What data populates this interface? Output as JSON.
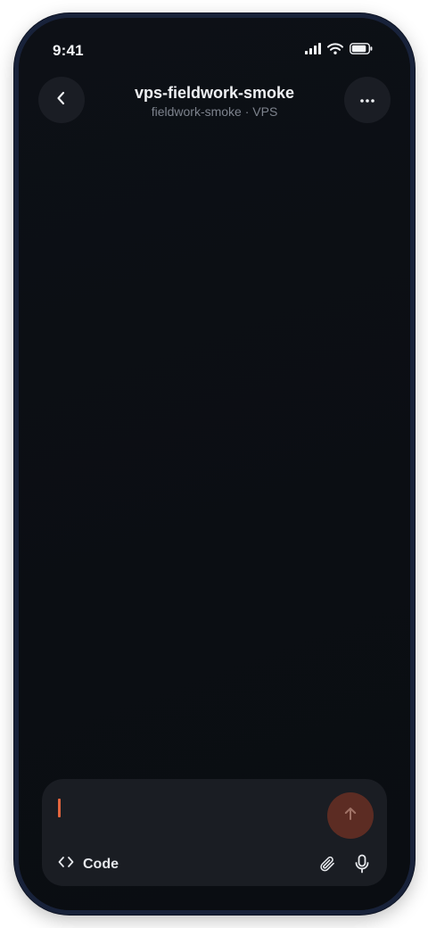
{
  "status_bar": {
    "time": "9:41",
    "icons": [
      "cellular-signal-icon",
      "wifi-icon",
      "battery-icon"
    ]
  },
  "header": {
    "title": "vps-fieldwork-smoke",
    "subtitle": "fieldwork-smoke · VPS",
    "back_icon": "chevron-left-icon",
    "more_icon": "more-horizontal-icon"
  },
  "composer": {
    "input_value": "",
    "input_placeholder": "",
    "mode_label": "Code",
    "mode_icon": "code-brackets-icon",
    "attach_icon": "paperclip-icon",
    "mic_icon": "microphone-icon",
    "send_icon": "arrow-up-icon"
  },
  "colors": {
    "background": "#0b0e14",
    "surface": "#1a1d23",
    "accent": "#e2653e",
    "send_disabled": "#5c2c23",
    "text_primary": "#eef0f3",
    "text_secondary": "#7d838d",
    "frame": "#18223a"
  }
}
